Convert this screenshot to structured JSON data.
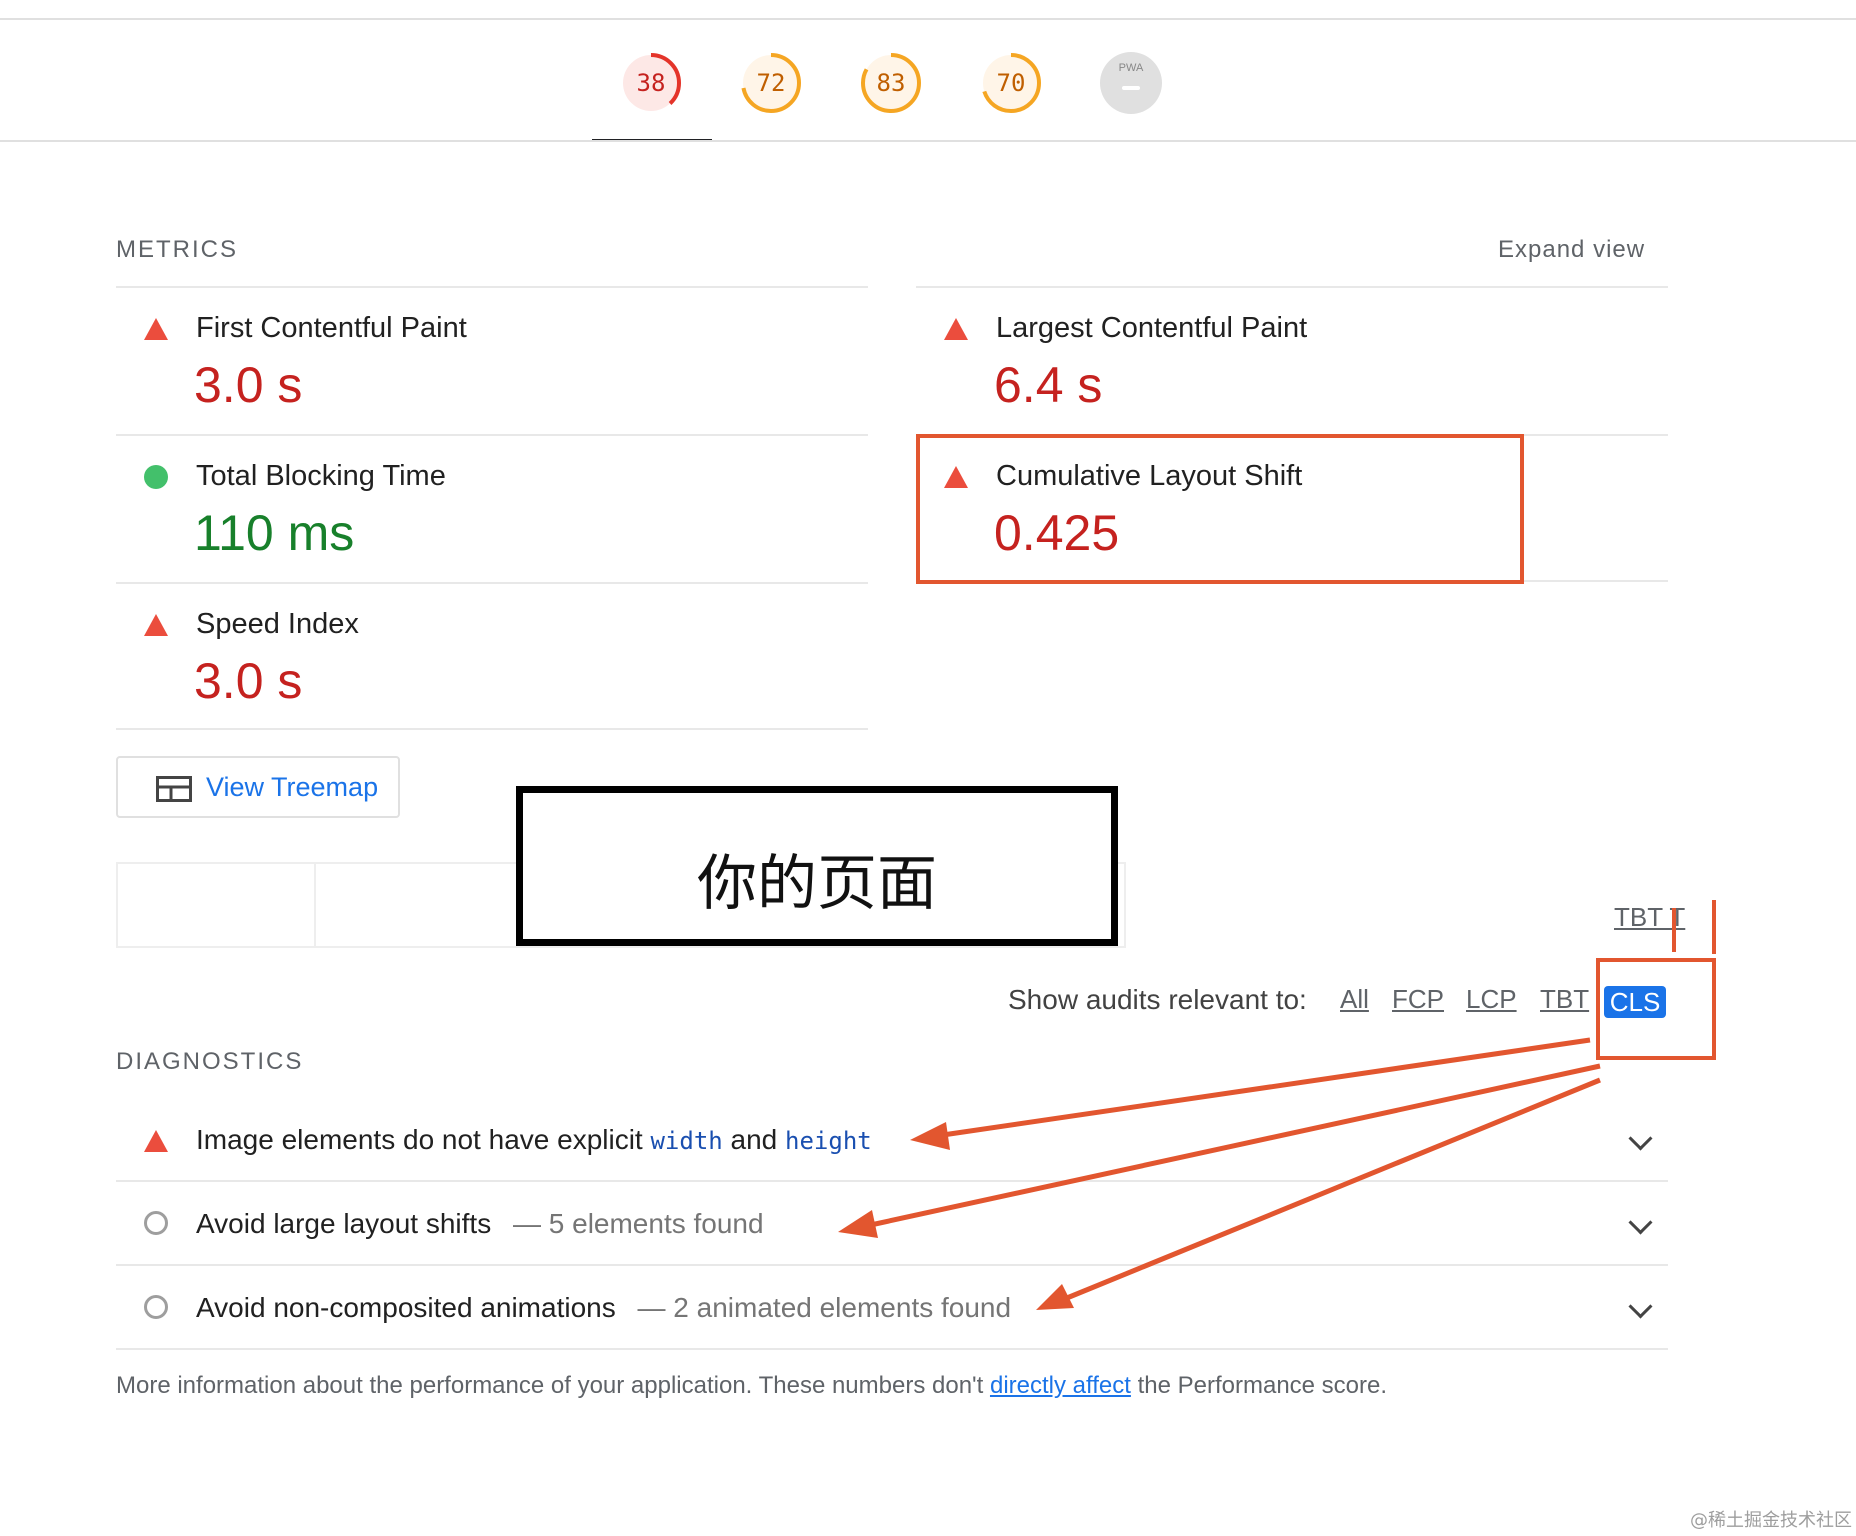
{
  "gauges": [
    {
      "value": "38",
      "score": 0.38,
      "color": "#e4342a",
      "bg": "#fde8e6"
    },
    {
      "value": "72",
      "score": 0.72,
      "color": "#f5a623",
      "bg": "#fff5e8"
    },
    {
      "value": "83",
      "score": 0.83,
      "color": "#f5a623",
      "bg": "#fff5e8"
    },
    {
      "value": "70",
      "score": 0.7,
      "color": "#f5a623",
      "bg": "#fff5e8"
    }
  ],
  "pwa": {
    "label": "PWA"
  },
  "metrics": {
    "heading": "METRICS",
    "expand_label": "Expand view",
    "items": [
      {
        "title": "First Contentful Paint",
        "value": "3.0 s",
        "status": "fail"
      },
      {
        "title": "Largest Contentful Paint",
        "value": "6.4 s",
        "status": "fail"
      },
      {
        "title": "Total Blocking Time",
        "value": "110 ms",
        "status": "pass"
      },
      {
        "title": "Cumulative Layout Shift",
        "value": "0.425",
        "status": "fail"
      },
      {
        "title": "Speed Index",
        "value": "3.0 s",
        "status": "fail"
      }
    ]
  },
  "treemap": {
    "label": "View Treemap"
  },
  "overlay": {
    "text": "你的页面"
  },
  "filter": {
    "label": "Show audits relevant to:",
    "options": [
      "All",
      "FCP",
      "LCP",
      "TBT",
      "CLS"
    ],
    "selected": "CLS",
    "floating": "TBT T"
  },
  "diagnostics": {
    "heading": "DIAGNOSTICS",
    "items": [
      {
        "title_a": "Image elements do not have explicit ",
        "code_a": "width",
        "title_b": " and ",
        "code_b": "height",
        "status": "fail"
      },
      {
        "title": "Avoid large layout shifts",
        "detail": "— 5 elements found",
        "status": "info"
      },
      {
        "title": "Avoid non-composited animations",
        "detail": "— 2 animated elements found",
        "status": "info"
      }
    ],
    "footnote_pre": "More information about the performance of your application. These numbers don't ",
    "footnote_link": "directly affect",
    "footnote_post": " the Performance score."
  },
  "annotation_color": "#e2562f",
  "watermark": "@稀土掘金技术社区"
}
